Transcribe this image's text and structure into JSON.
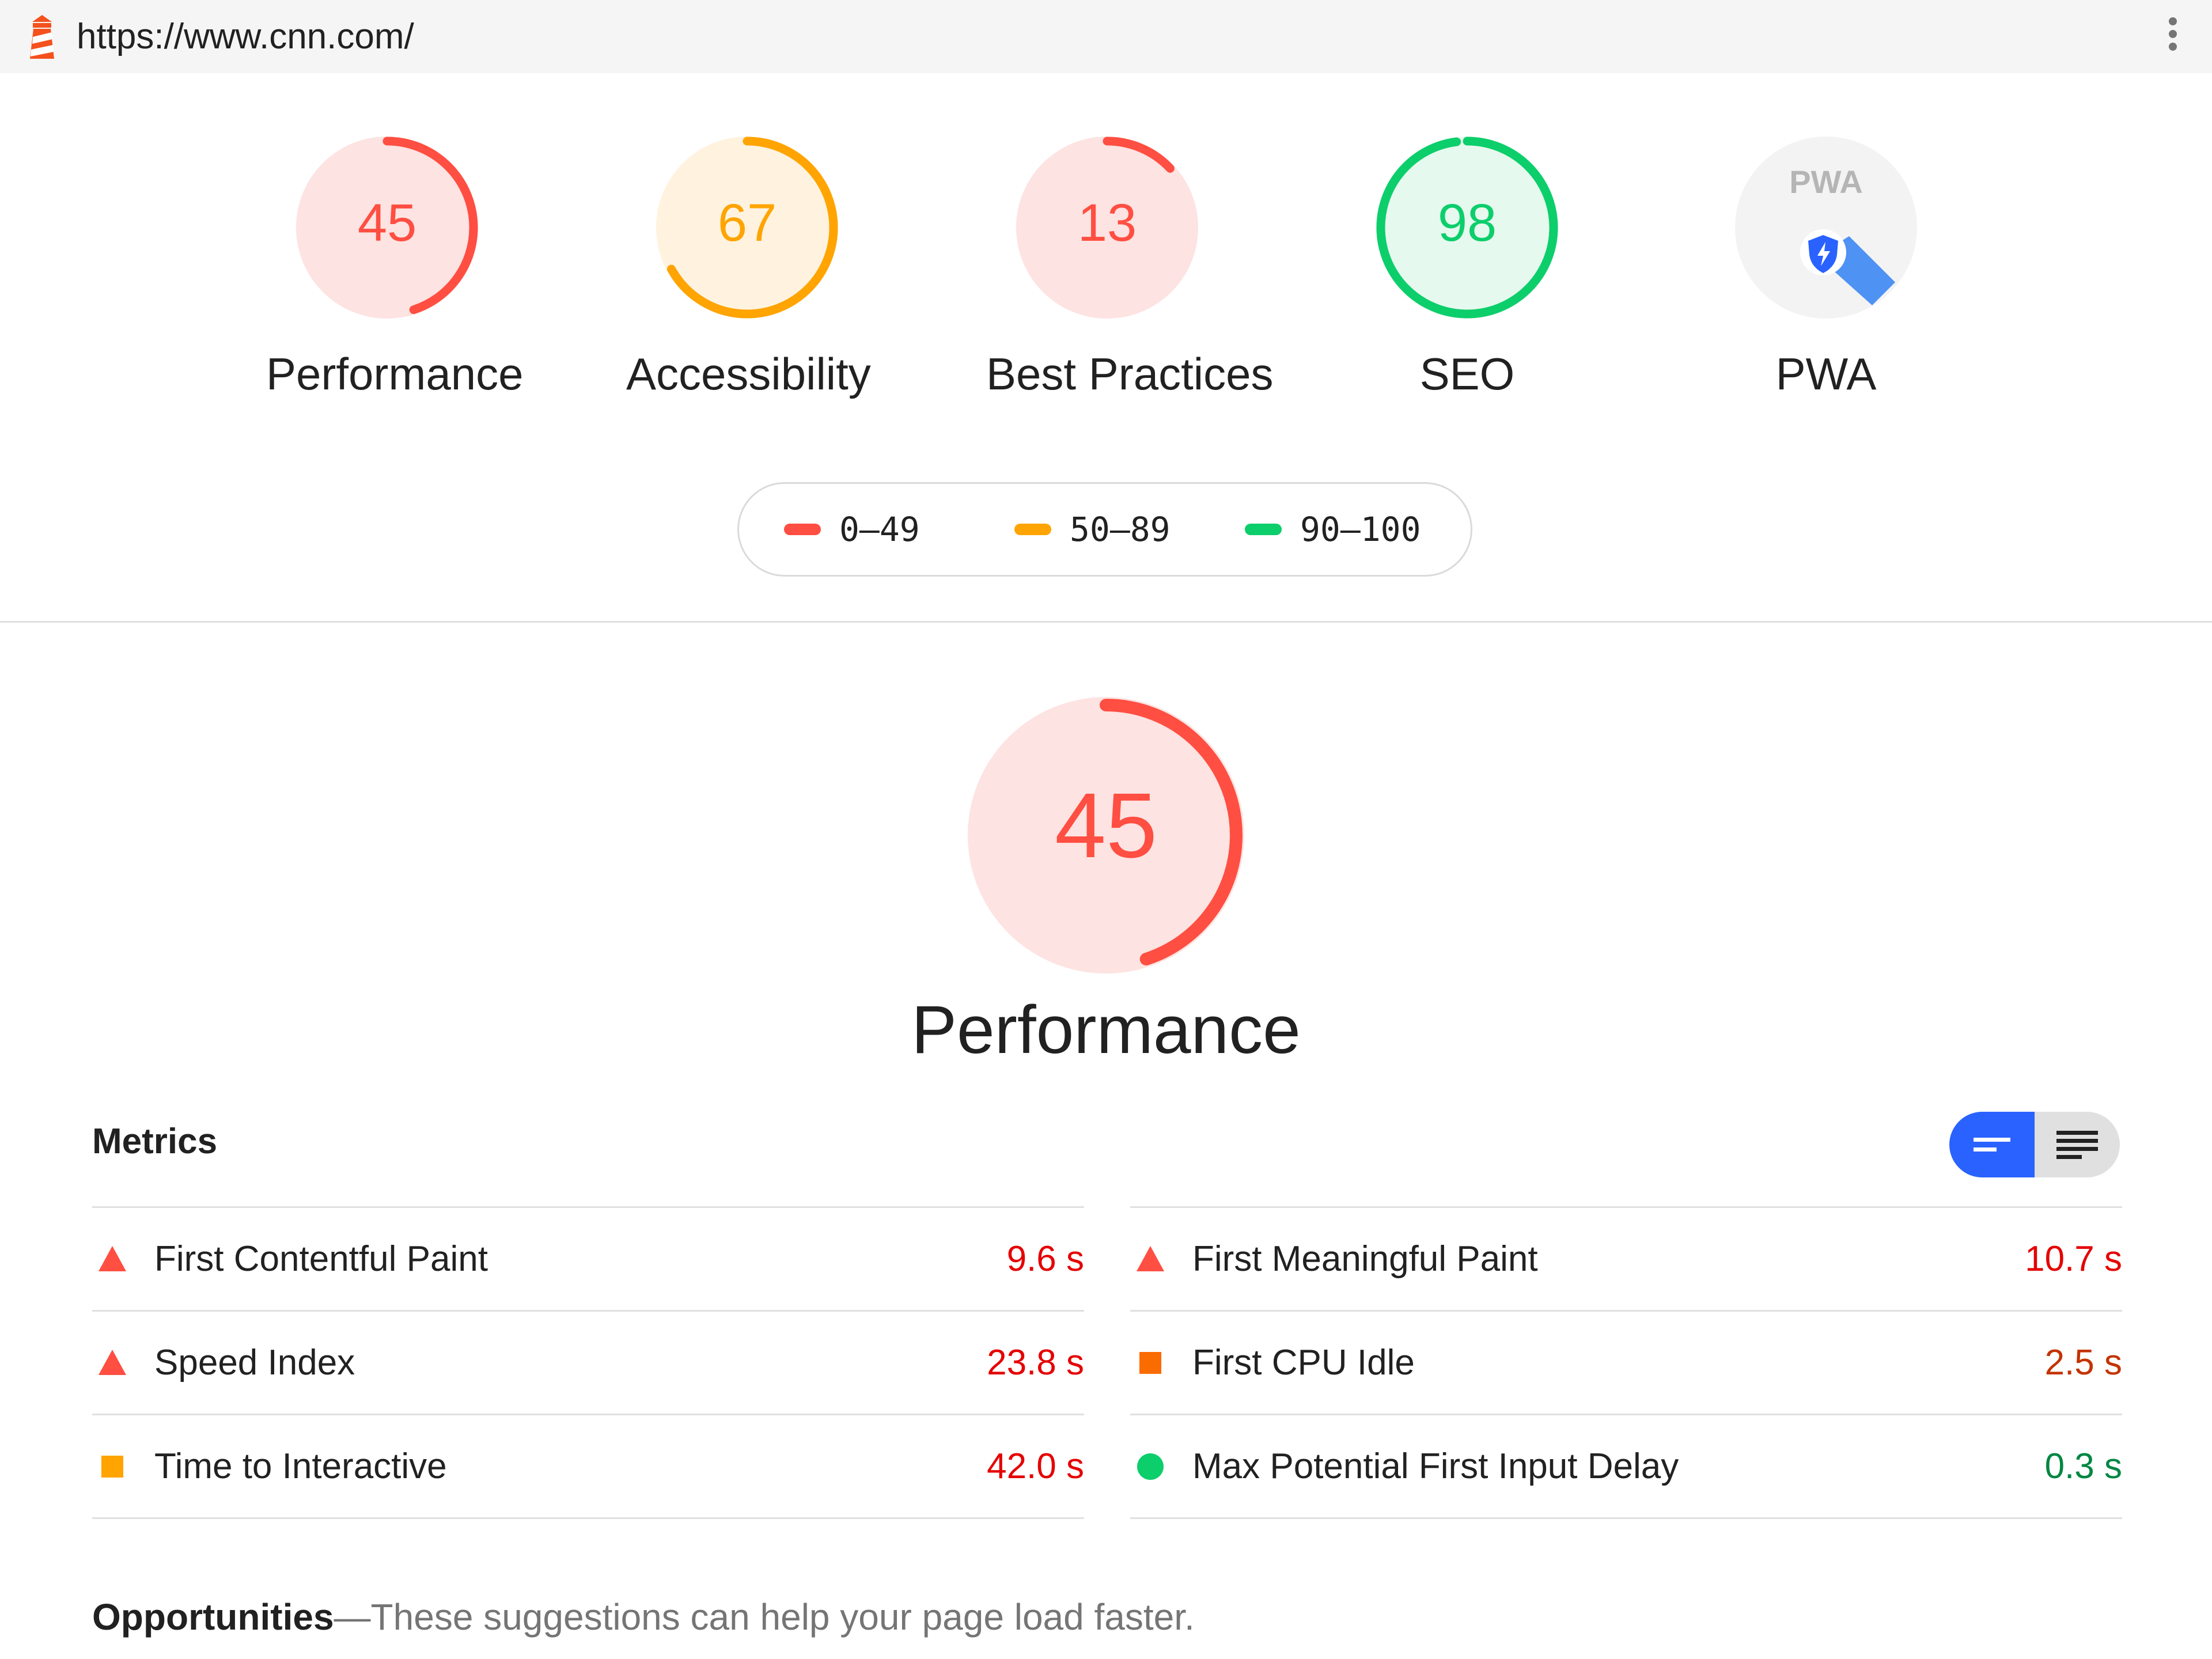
{
  "browser": {
    "url": "https://www.cnn.com/",
    "logo_icon": "lighthouse-icon",
    "menu_icon": "more-vert-icon"
  },
  "colors": {
    "fail": "#ff4e42",
    "average": "#ffa400",
    "pass": "#0cce6b",
    "fail_bg": "#fde3e1",
    "average_bg": "#fff3e0",
    "pass_bg": "#e6f9ee"
  },
  "categories": [
    {
      "score": "45",
      "value": 45,
      "label": "Performance",
      "rating": "fail"
    },
    {
      "score": "67",
      "value": 67,
      "label": "Accessibility",
      "rating": "average"
    },
    {
      "score": "13",
      "value": 13,
      "label": "Best Practices",
      "rating": "fail"
    },
    {
      "score": "98",
      "value": 98,
      "label": "SEO",
      "rating": "pass"
    }
  ],
  "pwa": {
    "label": "PWA",
    "badge_text": "PWA",
    "icon": "pwa-badge-icon"
  },
  "legend": [
    {
      "range": "0–49",
      "rating": "fail"
    },
    {
      "range": "50–89",
      "rating": "average"
    },
    {
      "range": "90–100",
      "rating": "pass"
    }
  ],
  "performance": {
    "score": "45",
    "value": 45,
    "title": "Performance"
  },
  "metrics": {
    "heading": "Metrics",
    "toggle": {
      "compact_icon": "compact-view-icon",
      "expanded_icon": "expanded-view-icon"
    },
    "left": [
      {
        "name": "First Contentful Paint",
        "value": "9.6 s",
        "icon": "fail-triangle-icon"
      },
      {
        "name": "Speed Index",
        "value": "23.8 s",
        "icon": "fail-triangle-icon"
      },
      {
        "name": "Time to Interactive",
        "value": "42.0 s",
        "icon": "average-square-icon"
      }
    ],
    "right": [
      {
        "name": "First Meaningful Paint",
        "value": "10.7 s",
        "icon": "fail-triangle-icon"
      },
      {
        "name": "First CPU Idle",
        "value": "2.5 s",
        "icon": "average-square-icon"
      },
      {
        "name": "Max Potential First Input Delay",
        "value": "0.3 s",
        "icon": "pass-circle-icon"
      }
    ],
    "value_colors": {
      "left": [
        "#e50000",
        "#e50000",
        "#e50000"
      ],
      "right": [
        "#e50000",
        "#c33300",
        "#018642"
      ]
    },
    "icon_colors": {
      "left": [
        "#ff4e42",
        "#ff4e42",
        "#ffa400"
      ],
      "right": [
        "#ff4e42",
        "#fa6b00",
        "#0cce6b"
      ]
    }
  },
  "opportunities": {
    "title": "Opportunities",
    "description": "—These suggestions can help your page load faster."
  }
}
